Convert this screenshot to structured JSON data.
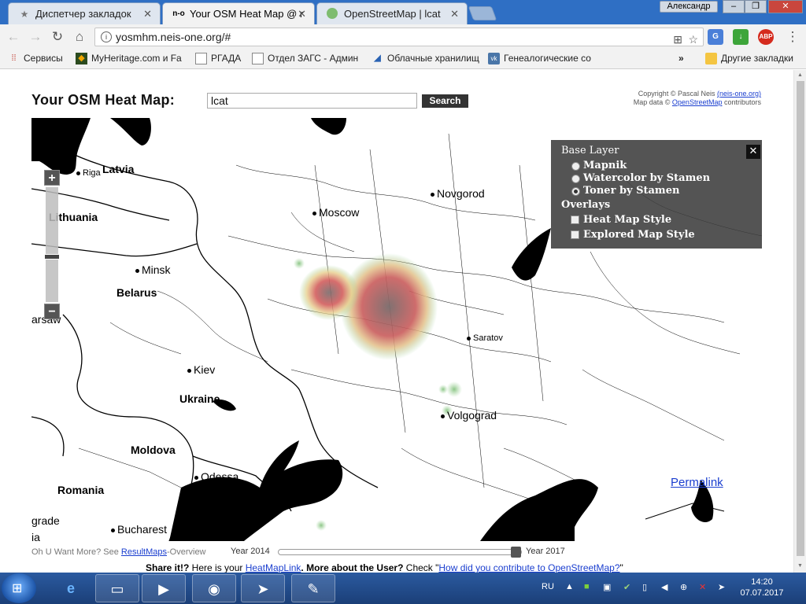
{
  "browser": {
    "tabs": [
      {
        "label": "Диспетчер закладок",
        "icon": "star-icon"
      },
      {
        "label": "Your OSM Heat Map @ r",
        "icon": "neis-icon",
        "icon_text": "n-o"
      },
      {
        "label": "OpenStreetMap | lcat",
        "icon": "osm-icon"
      }
    ],
    "user": "Александр",
    "window_buttons": [
      "–",
      "❐",
      "✕"
    ],
    "url": "yosmhm.neis-one.org/#",
    "bookmarks": [
      {
        "label": "Сервисы",
        "icon": "apps-icon"
      },
      {
        "label": "MyHeritage.com и Fa",
        "icon": "myheritage-icon"
      },
      {
        "label": "РГАДА",
        "icon": "page-icon"
      },
      {
        "label": "Отдел ЗАГС - Админ",
        "icon": "page-icon"
      },
      {
        "label": "Облачные хранилищ",
        "icon": "cloud-icon"
      },
      {
        "label": "Генеалогические со",
        "icon": "vk-icon"
      }
    ],
    "bookmarks_more": "»",
    "other_bookmarks": "Другие закладки",
    "extensions": [
      "translate-icon",
      "google-icon",
      "download-icon",
      "adblock-icon"
    ],
    "adblock_text": "ABP"
  },
  "page": {
    "title": "Your OSM Heat Map:",
    "search_value": "lcat",
    "search_label": "Search",
    "copyright_line1_prefix": "Copyright © Pascal Neis ",
    "copyright_line1_link": "(neis-one.org)",
    "copyright_line2_prefix": "Map data © ",
    "copyright_line2_link": "OpenStreetMap",
    "copyright_line2_suffix": " contributors",
    "permalink": "Permalink",
    "overview_prefix": "Oh U Want More? See ",
    "overview_link": "ResultMaps",
    "overview_suffix": "-Overview",
    "year_start": "Year 2014",
    "year_end": "Year 2017",
    "year_slider_position": 0.95,
    "share_bold1": "Share it!?",
    "share_text1": " Here is your ",
    "share_link1": "HeatMapLink",
    "share_bold2": ". More about the User?",
    "share_text2": " Check \"",
    "share_link2": "How did you contribute to OpenStreetMap?",
    "share_text3": "\""
  },
  "map": {
    "zoom_in": "+",
    "zoom_out": "−",
    "labels": {
      "riga": "Riga",
      "latvia": "Latvia",
      "lithuania": "Lithuania",
      "moscow": "Moscow",
      "novgorod": "Novgorod",
      "minsk": "Minsk",
      "belarus": "Belarus",
      "warsaw": "arsaw",
      "saratov": "Saratov",
      "kiev": "Kiev",
      "ukraine": "Ukraine",
      "volgograd": "Volgograd",
      "moldova": "Moldova",
      "odessa": "Odessa",
      "romania": "Romania",
      "belgrade": "grade",
      "bucharest": "Bucharest",
      "ia": "ia"
    },
    "layer_switcher": {
      "base_title": "Base Layer",
      "base_layers": [
        {
          "label": "Mapnik",
          "selected": false
        },
        {
          "label": "Watercolor by Stamen",
          "selected": false
        },
        {
          "label": "Toner by Stamen",
          "selected": true
        }
      ],
      "overlay_title": "Overlays",
      "overlays": [
        {
          "label": "Heat Map Style",
          "checked": false
        },
        {
          "label": "Explored Map Style",
          "checked": false
        }
      ],
      "close": "✕"
    }
  },
  "taskbar": {
    "apps": [
      "ie-icon",
      "explorer-icon",
      "media-player-icon",
      "chrome-icon",
      "telegram-icon",
      "paint-icon"
    ],
    "lang": "RU",
    "time": "14:20",
    "date": "07.07.2017"
  }
}
